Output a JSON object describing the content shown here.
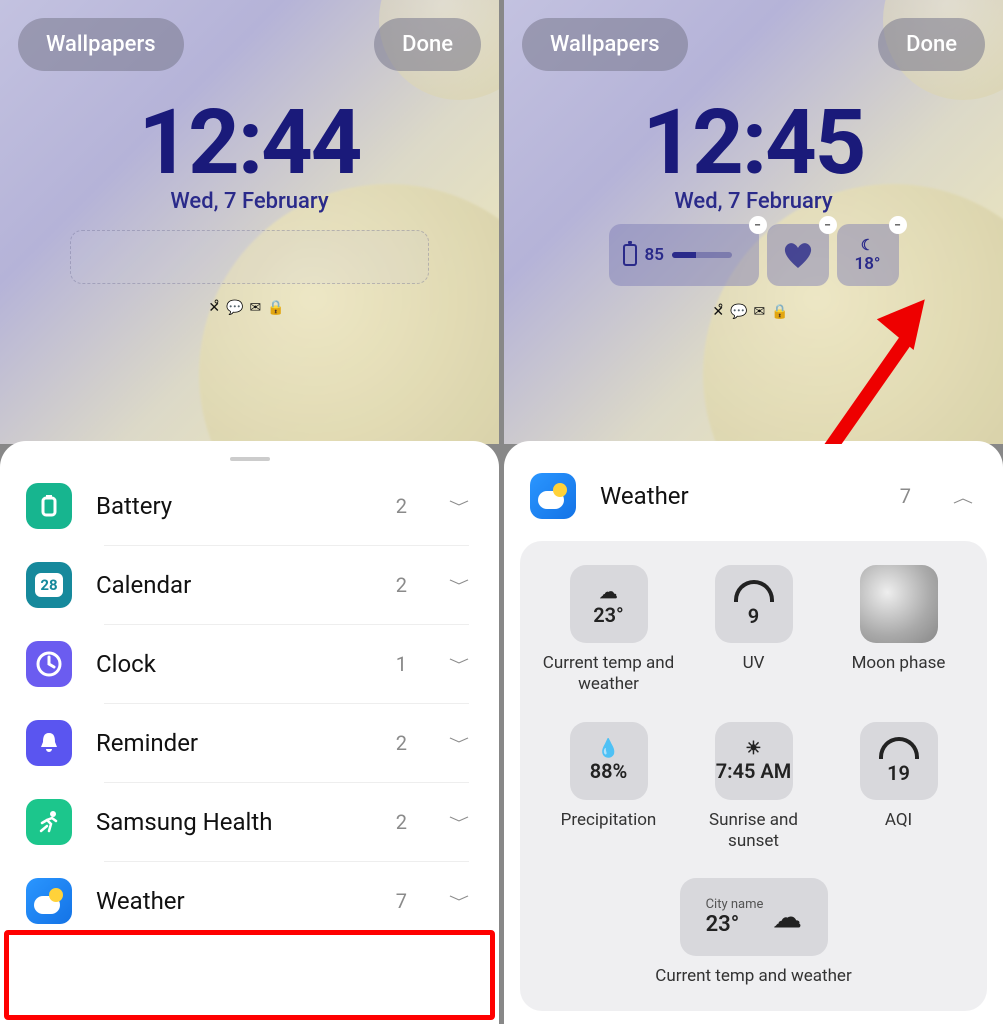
{
  "left": {
    "wallpapers_button": "Wallpapers",
    "done_button": "Done",
    "clock_time": "12:44",
    "clock_date": "Wed, 7 February",
    "status_icons": "missed-call chat mail lock",
    "rows": [
      {
        "id": "battery",
        "label": "Battery",
        "count": "2",
        "icon_bg": "#17b58f",
        "glyph": "▢"
      },
      {
        "id": "calendar",
        "label": "Calendar",
        "count": "2",
        "icon_bg": "#16899c",
        "glyph": "28"
      },
      {
        "id": "clock",
        "label": "Clock",
        "count": "1",
        "icon_bg": "#6b5cf0",
        "glyph": "clock"
      },
      {
        "id": "reminder",
        "label": "Reminder",
        "count": "2",
        "icon_bg": "#5a55f0",
        "glyph": "bell"
      },
      {
        "id": "health",
        "label": "Samsung Health",
        "count": "2",
        "icon_bg": "#1cc68c",
        "glyph": "run"
      },
      {
        "id": "weather",
        "label": "Weather",
        "count": "7",
        "icon_bg": "weather",
        "glyph": ""
      }
    ]
  },
  "right": {
    "wallpapers_button": "Wallpapers",
    "done_button": "Done",
    "clock_time": "12:45",
    "clock_date": "Wed, 7 February",
    "battery_widget_value": "85",
    "temp_widget_value": "18°",
    "header_label": "Weather",
    "header_count": "7",
    "widgets": [
      {
        "id": "curtemp",
        "top": "☁",
        "value": "23°",
        "label": "Current temp and weather"
      },
      {
        "id": "uv",
        "top": "arc",
        "value": "9",
        "label": "UV"
      },
      {
        "id": "moon",
        "top": "moon",
        "value": "",
        "label": "Moon phase"
      },
      {
        "id": "precip",
        "top": "💧",
        "value": "88%",
        "label": "Precipitation"
      },
      {
        "id": "sunrise",
        "top": "☀",
        "value": "7:45 AM",
        "label": "Sunrise and sunset"
      },
      {
        "id": "aqi",
        "top": "arc",
        "value": "19",
        "label": "AQI"
      },
      {
        "id": "citytemp",
        "city": "City name",
        "value": "23°",
        "label": "Current temp and weather"
      }
    ]
  }
}
